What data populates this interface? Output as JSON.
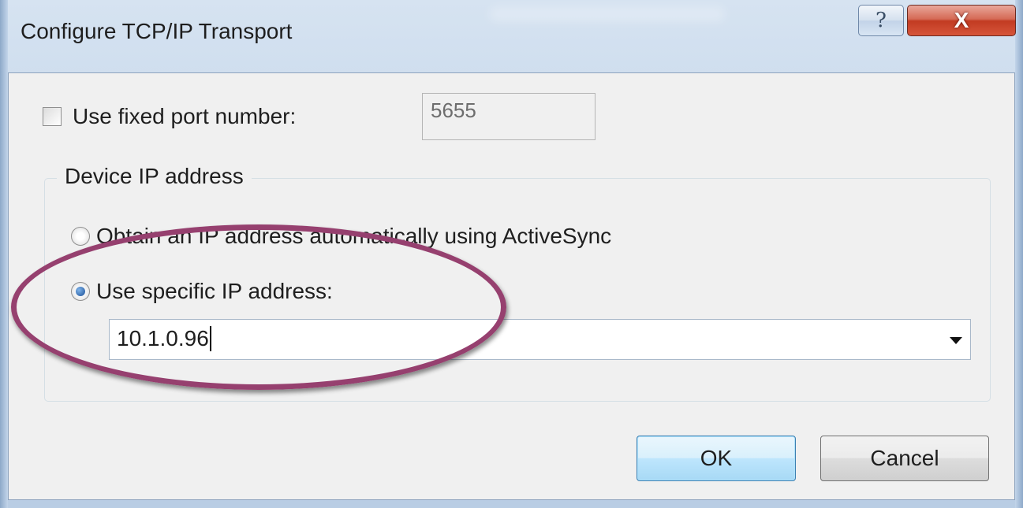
{
  "window": {
    "title": "Configure TCP/IP Transport",
    "help_glyph": "?",
    "close_glyph": "X"
  },
  "port": {
    "checkbox_label": "Use fixed port number:",
    "checked": false,
    "value": "5655"
  },
  "device_ip": {
    "group_label": "Device IP address",
    "option_auto_label": "Obtain an IP address automatically using ActiveSync",
    "option_specific_label": "Use specific IP address:",
    "selected_option": "specific",
    "ip_value": "10.1.0.96"
  },
  "buttons": {
    "ok_label": "OK",
    "cancel_label": "Cancel"
  },
  "icons": {
    "help": "question-mark-icon",
    "close": "close-x-icon",
    "dropdown": "dropdown-arrow-icon"
  },
  "colors": {
    "highlight_ellipse": "#96406f",
    "close_button": "#c23b22",
    "dialog_bg": "#f0f0f0"
  }
}
